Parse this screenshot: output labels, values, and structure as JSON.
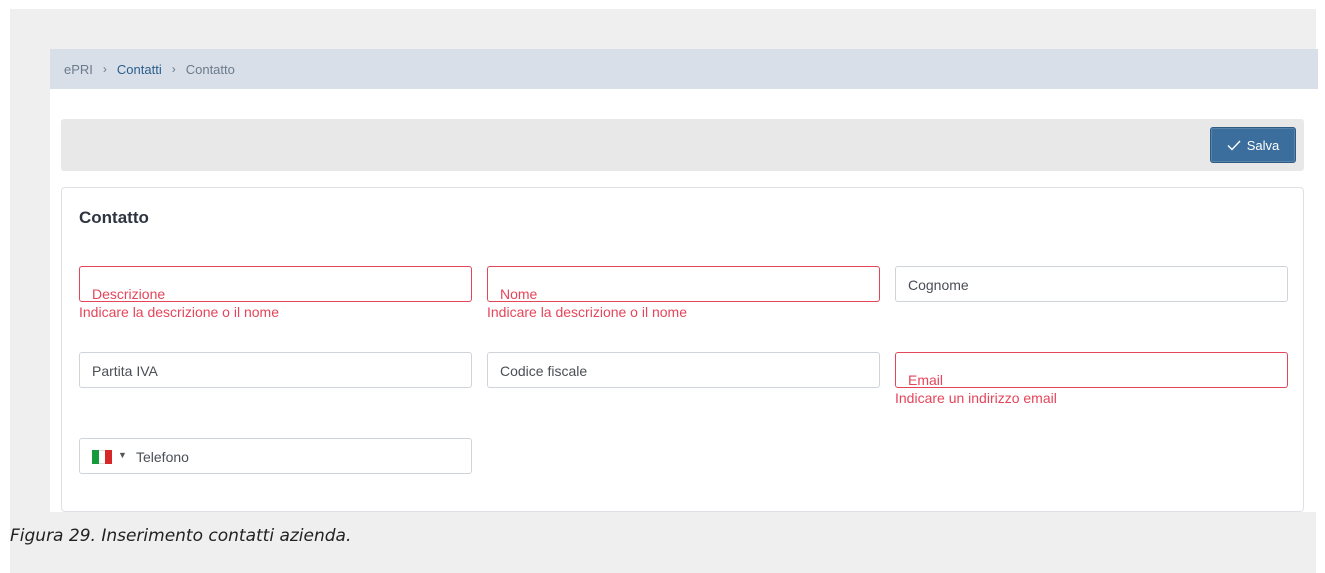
{
  "breadcrumb": {
    "root": "ePRI",
    "section": "Contatti",
    "current": "Contatto",
    "separator": "›"
  },
  "toolbar": {
    "save_label": "Salva",
    "save_icon": "check-icon"
  },
  "form": {
    "title": "Contatto",
    "descrizione": {
      "placeholder": "Descrizione",
      "error": "Indicare la descrizione o il nome"
    },
    "nome": {
      "placeholder": "Nome",
      "error": "Indicare la descrizione o il nome"
    },
    "cognome": {
      "placeholder": "Cognome"
    },
    "partita_iva": {
      "placeholder": "Partita IVA"
    },
    "codice_fiscale": {
      "placeholder": "Codice fiscale"
    },
    "email": {
      "placeholder": "Email",
      "error": "Indicare un indirizzo email"
    },
    "telefono": {
      "placeholder": "Telefono",
      "country": "italy-flag-icon"
    }
  },
  "caption": "Figura 29. Inserimento contatti azienda.",
  "colors": {
    "error": "#e5455a",
    "primary": "#3b6e9c",
    "breadcrumb_bg": "#d9dfe8"
  }
}
